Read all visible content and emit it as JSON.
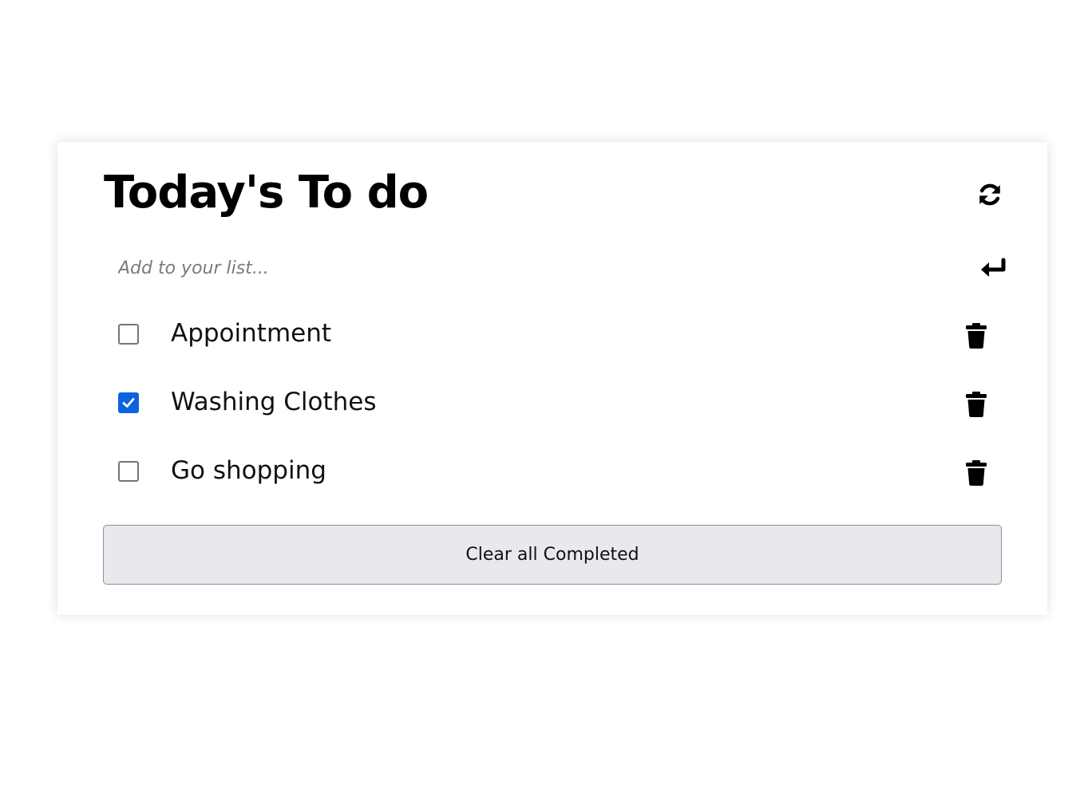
{
  "app": {
    "title": "Today's To do"
  },
  "header": {
    "refresh_icon": "refresh-icon"
  },
  "add": {
    "placeholder": "Add to your list...",
    "value": "",
    "enter_icon": "enter-return-icon"
  },
  "todos": [
    {
      "label": "Appointment",
      "completed": false
    },
    {
      "label": "Washing Clothes",
      "completed": true
    },
    {
      "label": "Go shopping",
      "completed": false
    }
  ],
  "footer": {
    "clear_label": "Clear all Completed"
  },
  "colors": {
    "checkbox_checked": "#0b63e0",
    "button_bg": "#e9e9ed",
    "button_border": "#8f8f9d",
    "text": "#000000"
  }
}
